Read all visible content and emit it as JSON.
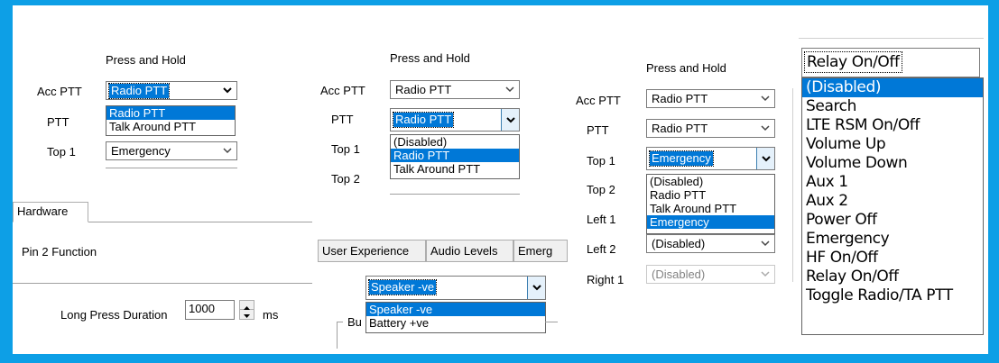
{
  "colors": {
    "frame": "#0d9fe6",
    "selection": "#0078d7"
  },
  "panel1": {
    "header": "Press and Hold",
    "rows": [
      {
        "label": "Acc PTT",
        "value": "Radio PTT"
      },
      {
        "label": "PTT",
        "value": ""
      },
      {
        "label": "Top 1",
        "value": "Emergency"
      }
    ],
    "dropdown_options": [
      "Radio PTT",
      "Talk Around PTT"
    ],
    "tab": "Hardware",
    "pin_label": "Pin 2 Function",
    "long_press_label": "Long Press Duration",
    "long_press_value": "1000",
    "unit": "ms"
  },
  "panel2": {
    "header": "Press and Hold",
    "rows": [
      {
        "label": "Acc PTT",
        "value": "Radio PTT"
      },
      {
        "label": "PTT",
        "value": "Radio PTT"
      },
      {
        "label": "Top 1",
        "value": ""
      },
      {
        "label": "Top 2",
        "value": ""
      }
    ],
    "dropdown_options": [
      "(Disabled)",
      "Radio PTT",
      "Talk Around PTT"
    ],
    "tabs": [
      "User Experience",
      "Audio Levels",
      "Emerg"
    ],
    "speaker_value": "Speaker -ve",
    "speaker_options": [
      "Speaker -ve",
      "Battery +ve"
    ],
    "group_label": "Bu"
  },
  "panel3": {
    "header": "Press and Hold",
    "rows": [
      {
        "label": "Acc PTT",
        "value": "Radio PTT"
      },
      {
        "label": "PTT",
        "value": "Radio PTT"
      },
      {
        "label": "Top 1",
        "value": "Emergency"
      },
      {
        "label": "Top 2",
        "value": ""
      },
      {
        "label": "Left 1",
        "value": ""
      },
      {
        "label": "Left 2",
        "value": "(Disabled)"
      },
      {
        "label": "Right 1",
        "value": "(Disabled)"
      }
    ],
    "dropdown_options": [
      "(Disabled)",
      "Radio PTT",
      "Talk Around PTT",
      "Emergency"
    ]
  },
  "panel4": {
    "value": "Relay On/Off",
    "options": [
      "(Disabled)",
      "Search",
      "LTE RSM On/Off",
      "Volume Up",
      "Volume Down",
      "Aux 1",
      "Aux 2",
      "Power Off",
      "Emergency",
      "HF On/Off",
      "Relay On/Off",
      "Toggle Radio/TA PTT"
    ]
  }
}
